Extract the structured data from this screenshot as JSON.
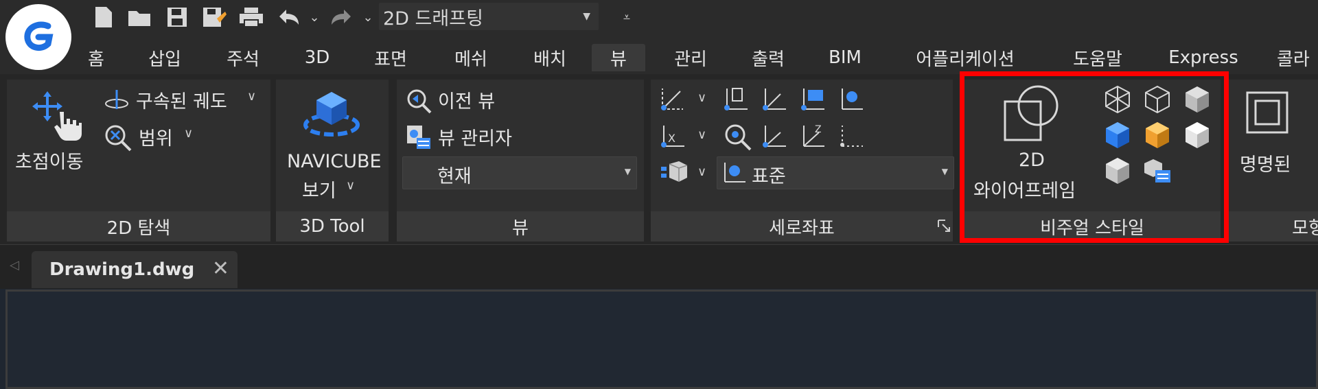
{
  "quick_access": {
    "workspace": "2D 드래프팅",
    "icons": [
      "new-file-icon",
      "open-folder-icon",
      "save-icon",
      "save-as-icon",
      "print-icon",
      "undo-icon",
      "redo-icon"
    ]
  },
  "tabs": [
    "홈",
    "삽입",
    "주석",
    "3D",
    "표면",
    "메쉬",
    "배치",
    "뷰",
    "관리",
    "출력",
    "BIM",
    "어플리케이션",
    "도움말",
    "Express",
    "콜라"
  ],
  "active_tab": "뷰",
  "panels": {
    "nav2d": {
      "title": "2D 탐색",
      "pan": "초점이동",
      "orbit": "구속된 궤도",
      "extent": "범위"
    },
    "tool3d": {
      "title": "3D Tool",
      "navicube_line1": "NAVICUBE",
      "navicube_line2": "보기"
    },
    "view": {
      "title": "뷰",
      "previous": "이전 뷰",
      "manager": "뷰 관리자",
      "current": "현재"
    },
    "ucs": {
      "title": "세로좌표",
      "standard": "표준"
    },
    "visual": {
      "title": "비주얼 스타일",
      "wire_line1": "2D",
      "wire_line2": "와이어프레임"
    },
    "model": {
      "title": "모형",
      "named": "명명된"
    }
  },
  "document": {
    "tab": "Drawing1.dwg"
  },
  "colors": {
    "accent_red": "#ff0000",
    "logo_blue": "#1e6fe0",
    "cube_orange": "#f0a030",
    "cube_blue": "#2d7ff0"
  }
}
